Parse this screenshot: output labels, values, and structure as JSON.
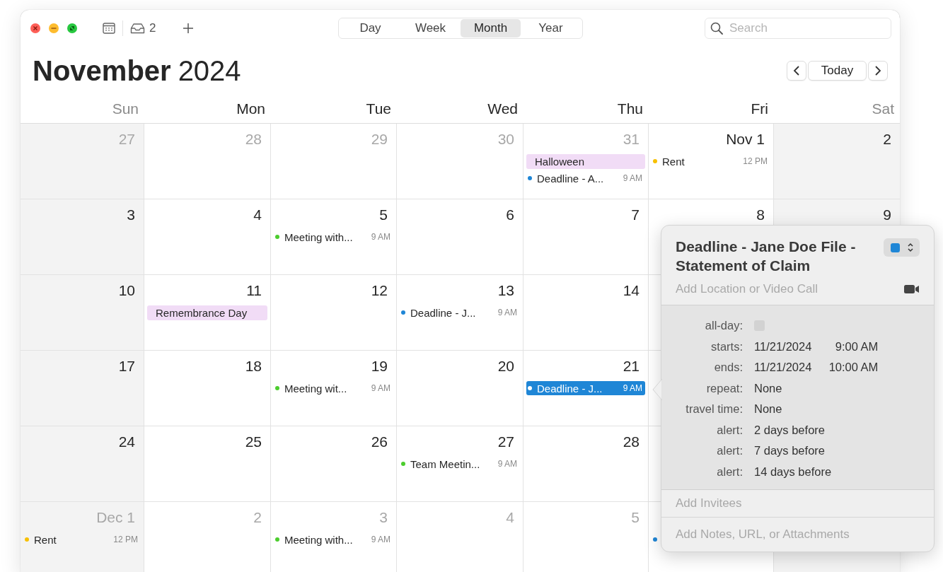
{
  "toolbar": {
    "inbox_count": "2",
    "views": [
      {
        "label": "Day",
        "selected": false
      },
      {
        "label": "Week",
        "selected": false
      },
      {
        "label": "Month",
        "selected": true
      },
      {
        "label": "Year",
        "selected": false
      }
    ],
    "search": {
      "placeholder": "Search"
    }
  },
  "header": {
    "month": "November",
    "year": "2024",
    "today": "Today"
  },
  "weekdays": [
    {
      "label": "Sun",
      "weekend": true
    },
    {
      "label": "Mon",
      "weekend": false
    },
    {
      "label": "Tue",
      "weekend": false
    },
    {
      "label": "Wed",
      "weekend": false
    },
    {
      "label": "Thu",
      "weekend": false
    },
    {
      "label": "Fri",
      "weekend": false
    },
    {
      "label": "Sat",
      "weekend": true
    }
  ],
  "weeks": [
    {
      "days": [
        {
          "label": "27",
          "in_month": false,
          "weekend": true
        },
        {
          "label": "28",
          "in_month": false,
          "weekend": false
        },
        {
          "label": "29",
          "in_month": false,
          "weekend": false
        },
        {
          "label": "30",
          "in_month": false,
          "weekend": false
        },
        {
          "label": "31",
          "in_month": false,
          "weekend": false,
          "events": [
            {
              "kind": "allday",
              "title": "Halloween",
              "color": "#f1dcf6",
              "selected": false
            },
            {
              "kind": "timed",
              "title": "Deadline - A...",
              "time": "9 AM",
              "color": "#1f86d6",
              "selected": false
            }
          ]
        },
        {
          "label": "Nov 1",
          "in_month": true,
          "weekend": false,
          "events": [
            {
              "kind": "timed",
              "title": "Rent",
              "time": "12 PM",
              "color": "#f7c000",
              "selected": false
            }
          ]
        },
        {
          "label": "2",
          "in_month": true,
          "weekend": true
        }
      ]
    },
    {
      "days": [
        {
          "label": "3",
          "in_month": true,
          "weekend": true
        },
        {
          "label": "4",
          "in_month": true,
          "weekend": false
        },
        {
          "label": "5",
          "in_month": true,
          "weekend": false,
          "events": [
            {
              "kind": "timed",
              "title": "Meeting with...",
              "time": "9 AM",
              "color": "#4ccd2e",
              "selected": false
            }
          ]
        },
        {
          "label": "6",
          "in_month": true,
          "weekend": false
        },
        {
          "label": "7",
          "in_month": true,
          "weekend": false
        },
        {
          "label": "8",
          "in_month": true,
          "weekend": false
        },
        {
          "label": "9",
          "in_month": true,
          "weekend": true
        }
      ]
    },
    {
      "days": [
        {
          "label": "10",
          "in_month": true,
          "weekend": true
        },
        {
          "label": "11",
          "in_month": true,
          "weekend": false,
          "events": [
            {
              "kind": "allday",
              "title": "Remembrance Day",
              "color": "#f1dcf6",
              "selected": false
            }
          ]
        },
        {
          "label": "12",
          "in_month": true,
          "weekend": false
        },
        {
          "label": "13",
          "in_month": true,
          "weekend": false,
          "events": [
            {
              "kind": "timed",
              "title": "Deadline - J...",
              "time": "9 AM",
              "color": "#1f86d6",
              "selected": false
            }
          ]
        },
        {
          "label": "14",
          "in_month": true,
          "weekend": false
        },
        {
          "weekend": false
        }
      ]
    },
    {
      "days": [
        {
          "label": "17",
          "in_month": true,
          "weekend": true
        },
        {
          "label": "18",
          "in_month": true,
          "weekend": false
        },
        {
          "label": "19",
          "in_month": true,
          "weekend": false,
          "events": [
            {
              "kind": "timed",
              "title": "Meeting wit...",
              "time": "9 AM",
              "color": "#4ccd2e",
              "selected": false
            }
          ]
        },
        {
          "label": "20",
          "in_month": true,
          "weekend": false
        },
        {
          "label": "21",
          "in_month": true,
          "weekend": false,
          "events": [
            {
              "kind": "timed",
              "title": "Deadline - J...",
              "time": "9 AM",
              "color": "#1f86d6",
              "selected": true
            }
          ]
        },
        {
          "weekend": false
        }
      ]
    },
    {
      "days": [
        {
          "label": "24",
          "in_month": true,
          "weekend": true
        },
        {
          "label": "25",
          "in_month": true,
          "weekend": false
        },
        {
          "label": "26",
          "in_month": true,
          "weekend": false
        },
        {
          "label": "27",
          "in_month": true,
          "weekend": false,
          "events": [
            {
              "kind": "timed",
              "title": "Team Meetin...",
              "time": "9 AM",
              "color": "#4ccd2e",
              "selected": false
            }
          ]
        },
        {
          "label": "28",
          "in_month": true,
          "weekend": false
        },
        {
          "weekend": false
        }
      ]
    },
    {
      "days": [
        {
          "label": "Dec 1",
          "in_month": false,
          "weekend": true,
          "events": [
            {
              "kind": "timed",
              "title": "Rent",
              "time": "12 PM",
              "color": "#f7c000",
              "selected": false
            }
          ]
        },
        {
          "label": "2",
          "in_month": false,
          "weekend": false
        },
        {
          "label": "3",
          "in_month": false,
          "weekend": false,
          "events": [
            {
              "kind": "timed",
              "title": "Meeting with...",
              "time": "9 AM",
              "color": "#4ccd2e",
              "selected": false
            }
          ]
        },
        {
          "label": "4",
          "in_month": false,
          "weekend": false
        },
        {
          "label": "5",
          "in_month": false,
          "weekend": false
        },
        {
          "weekend": false,
          "events": [
            {
              "kind": "timed",
              "color": "#1f86d6"
            }
          ]
        },
        {
          "weekend": true
        }
      ]
    }
  ],
  "popover": {
    "title": "Deadline - Jane Doe File - Statement of Claim",
    "location_placeholder": "Add Location or Video Call",
    "rows": [
      {
        "kind": "checkbox",
        "label": "all-day:",
        "checked": false
      },
      {
        "kind": "datetime",
        "label": "starts:",
        "date": "11/21/2024",
        "time": "9:00 AM"
      },
      {
        "kind": "datetime",
        "label": "ends:",
        "date": "11/21/2024",
        "time": "10:00 AM"
      },
      {
        "kind": "text",
        "label": "repeat:",
        "value": "None"
      },
      {
        "kind": "text",
        "label": "travel time:",
        "value": "None"
      },
      {
        "kind": "text",
        "label": "alert:",
        "value": "2 days before"
      },
      {
        "kind": "text",
        "label": "alert:",
        "value": "7 days before"
      },
      {
        "kind": "text",
        "label": "alert:",
        "value": "14 days before"
      }
    ],
    "invitees_placeholder": "Add Invitees",
    "notes_placeholder": "Add Notes, URL, or Attachments"
  }
}
